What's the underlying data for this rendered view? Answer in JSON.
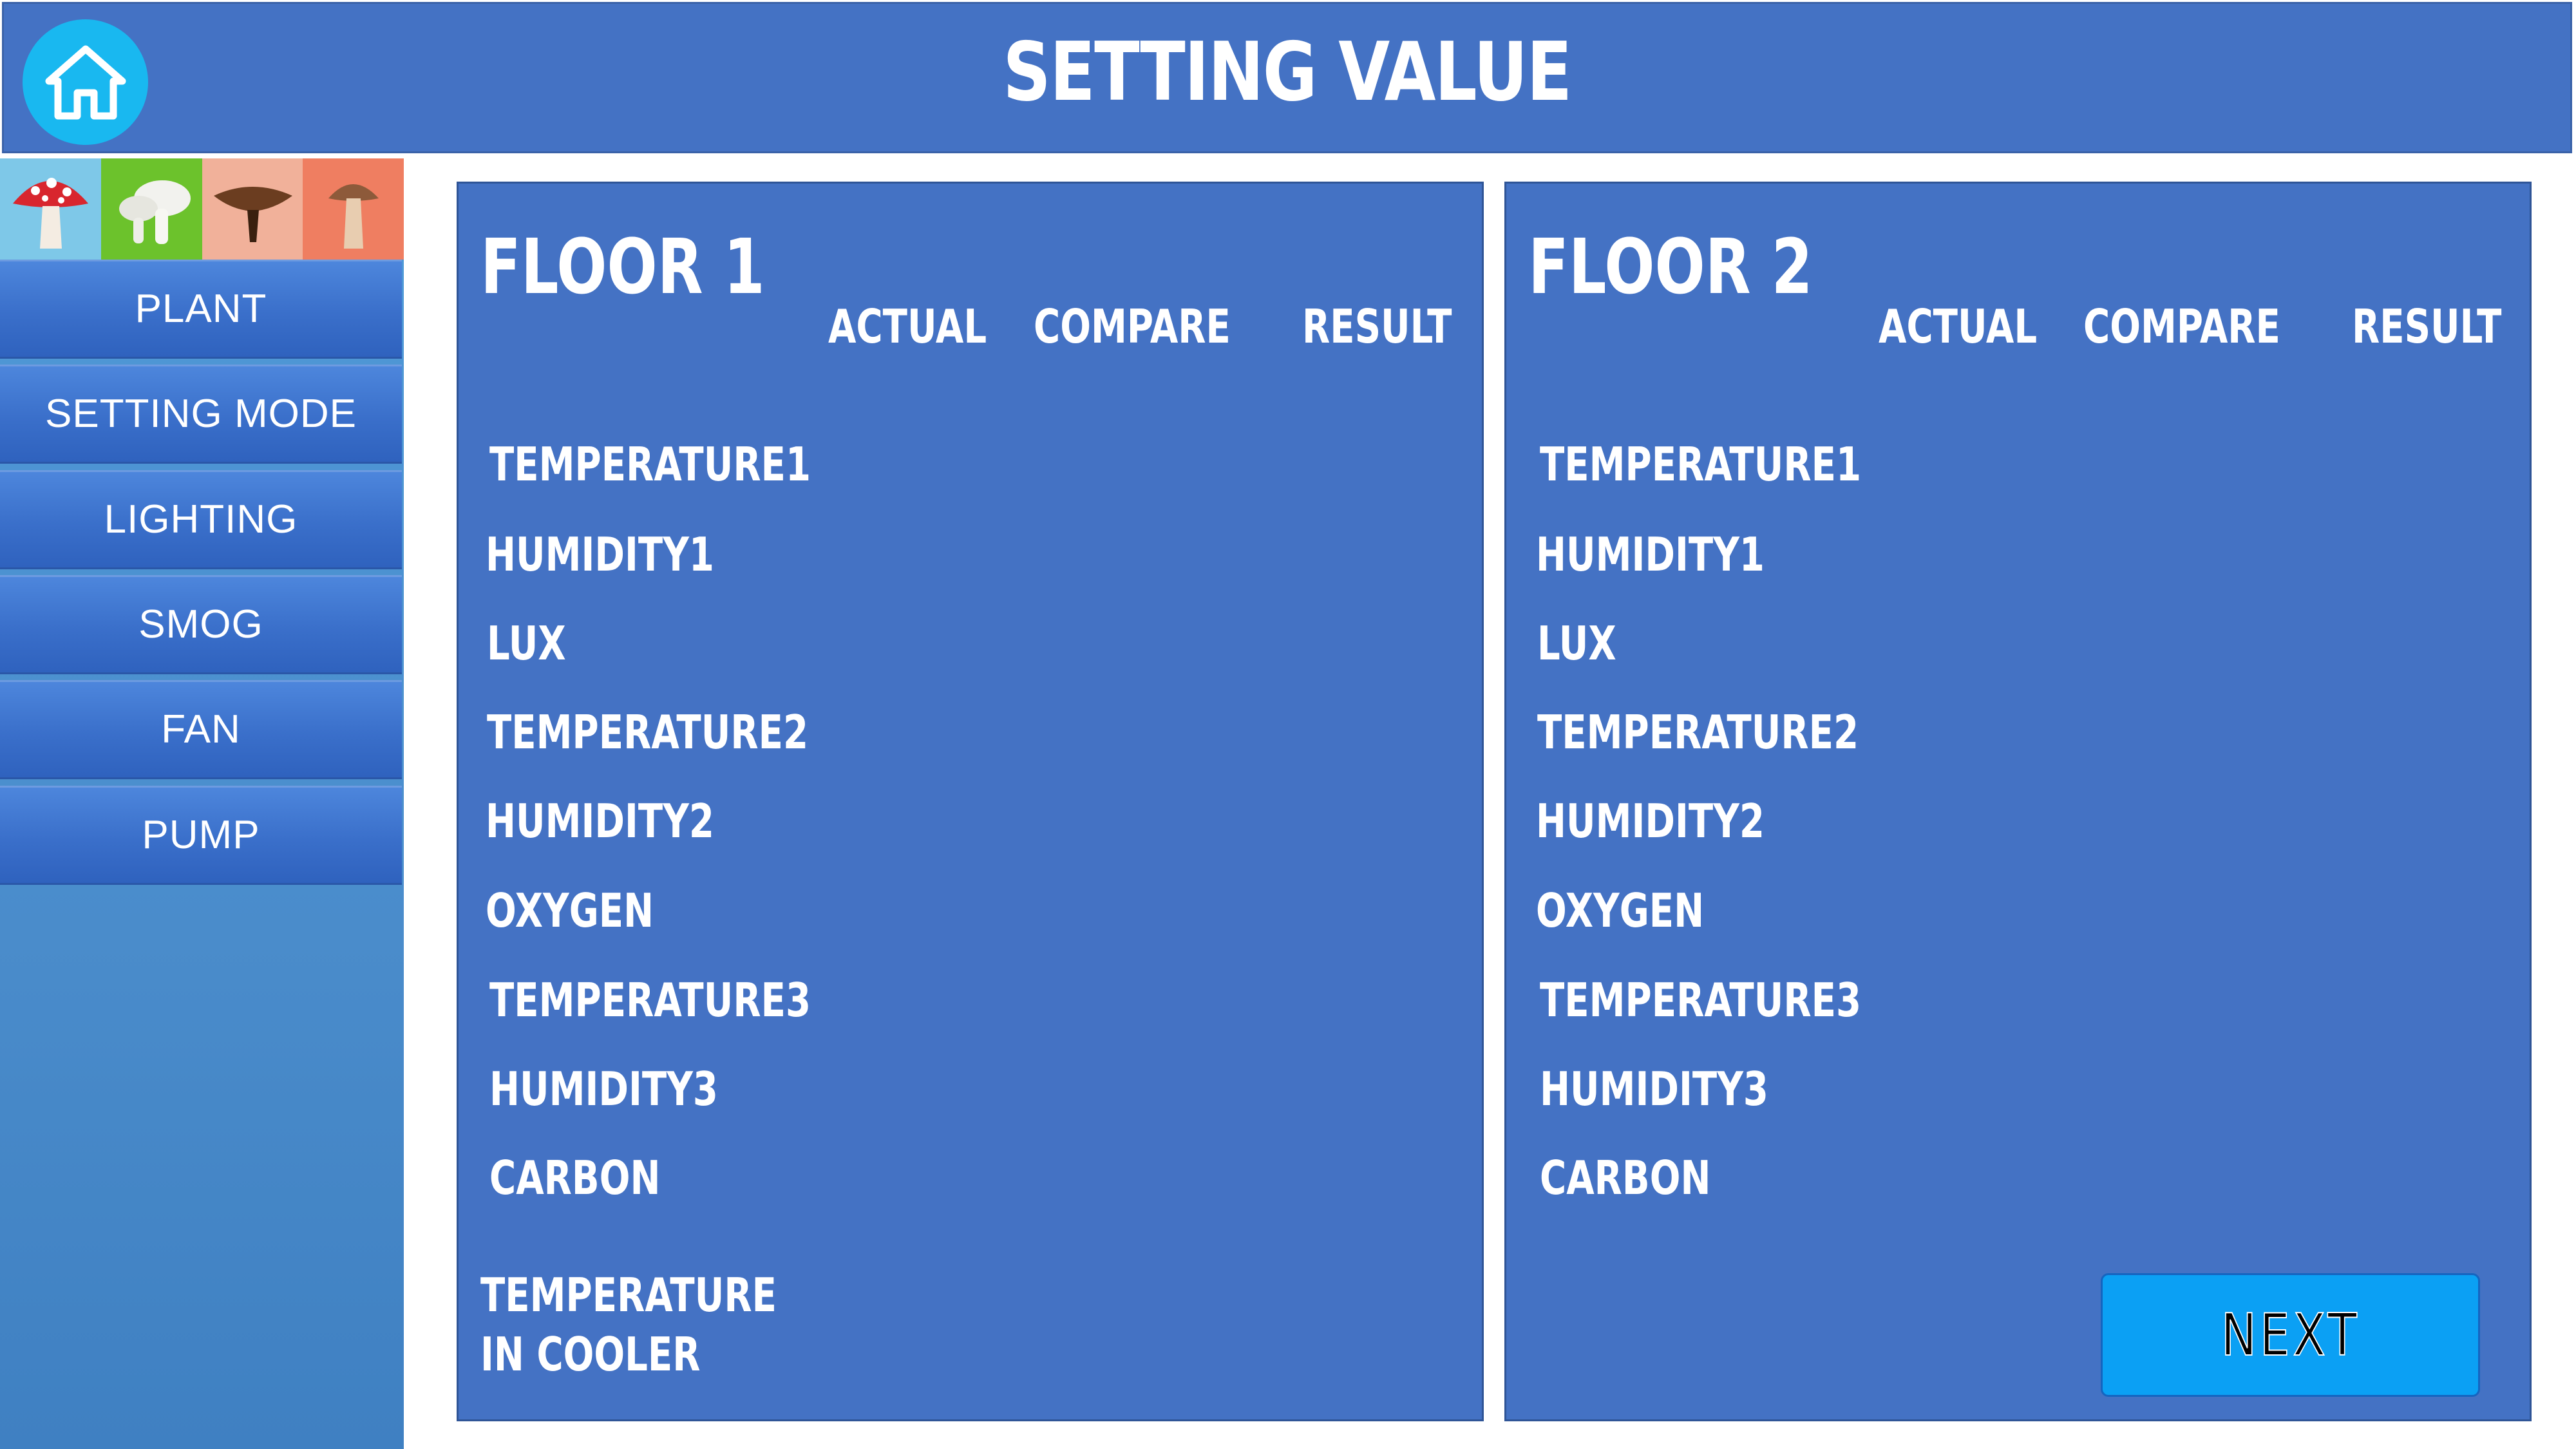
{
  "header": {
    "title": "SETTING VALUE",
    "home_icon": "home-icon"
  },
  "sidebar": {
    "thumbnails": [
      {
        "icon": "red-mushroom-icon",
        "bg": "#7ec8e8"
      },
      {
        "icon": "white-mushroom-icon",
        "bg": "#6cc22c"
      },
      {
        "icon": "brown-mushroom-icon",
        "bg": "#f1b19a"
      },
      {
        "icon": "tall-mushroom-icon",
        "bg": "#ef7e61"
      }
    ],
    "items": [
      {
        "label": "PLANT"
      },
      {
        "label": "SETTING MODE"
      },
      {
        "label": "LIGHTING"
      },
      {
        "label": "SMOG"
      },
      {
        "label": "FAN"
      },
      {
        "label": "PUMP"
      }
    ]
  },
  "floors": [
    {
      "title": "FLOOR 1",
      "columns": [
        "ACTUAL",
        "COMPARE",
        "RESULT"
      ],
      "rows": [
        "TEMPERATURE1",
        "HUMIDITY1",
        "LUX",
        "TEMPERATURE2",
        "HUMIDITY2",
        "OXYGEN",
        "TEMPERATURE3",
        "HUMIDITY3",
        "CARBON"
      ],
      "extra_label_line1": "TEMPERATURE",
      "extra_label_line2": "IN COOLER"
    },
    {
      "title": "FLOOR 2",
      "columns": [
        "ACTUAL",
        "COMPARE",
        "RESULT"
      ],
      "rows": [
        "TEMPERATURE1",
        "HUMIDITY1",
        "LUX",
        "TEMPERATURE2",
        "HUMIDITY2",
        "OXYGEN",
        "TEMPERATURE3",
        "HUMIDITY3",
        "CARBON"
      ]
    }
  ],
  "next_button": {
    "label": "NEXT"
  },
  "colors": {
    "panel": "#4472c4",
    "home_button": "#19b8f0",
    "next_button": "#0ba0f4"
  }
}
